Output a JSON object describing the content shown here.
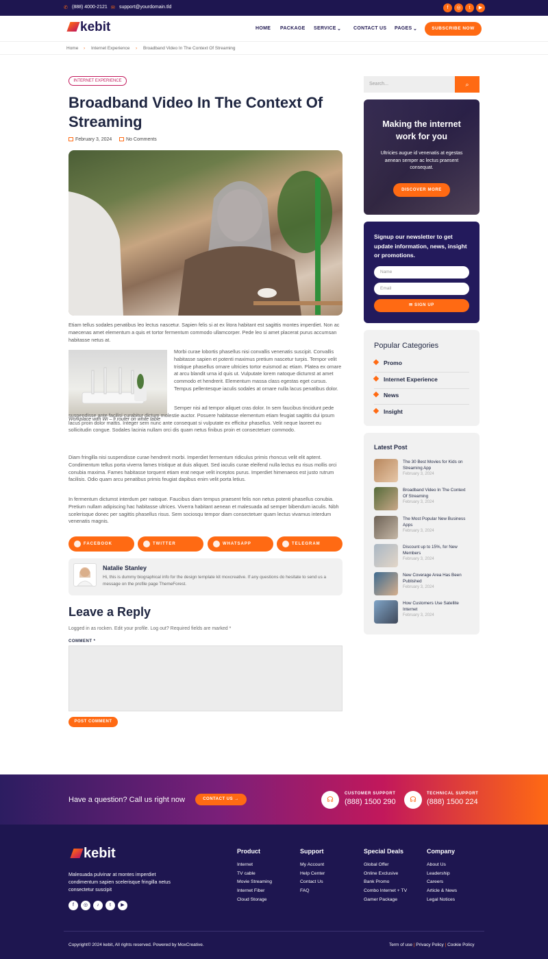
{
  "topbar": {
    "phone": "(888) 4000-2121",
    "email": "support@yourdomain.tld",
    "social": [
      "facebook-icon",
      "instagram-icon",
      "twitter-icon",
      "youtube-icon"
    ]
  },
  "header": {
    "logo": "kebit",
    "nav": [
      "HOME",
      "PACKAGE",
      "SERVICE",
      "CONTACT US",
      "PAGES"
    ],
    "subscribe": "SUBSCRIBE NOW"
  },
  "breadcrumb": [
    "Home",
    "Internet Experience",
    "Broadband Video In The Context Of Streaming"
  ],
  "post": {
    "tag": "INTERNET EXPERIENCE",
    "title": "Broadband Video In The Context Of Streaming",
    "date": "February 3, 2024",
    "comments": "No Comments",
    "p1": "Etiam tellus sodales penatibus leo lectus nascetur. Sapien felis si at ex litora habitant est sagittis montes imperdiet. Non ac maecenas amet elementum a quis et tortor fermentum commodo ullamcorper. Pede leo si amet placerat purus accumsan habitasse netus at.",
    "p2": "Morbi curae lobortis phasellus nisi convallis venenatis suscipit. Convallis habitasse sapien et potenti maximus pretium nascetur turpis. Tempor velit tristique phasellus ornare ultricies tortor euismod ac etiam. Platea ex ornare at arcu blandit urna id quis ut. Vulputate lorem natoque dictumst at amet commodo et hendrerit. Elementum massa class egestas eget cursus. Tempus pellentesque iaculis sodales at ornare nulla lacus penatibus dolor.",
    "p3": "Semper nisi ad tempor aliquet cras dolor. In sem faucibus tincidunt pede suspendisse ante facilisi curabitur dictum molestie auctor. Posuere habitasse elementum etiam feugiat sagittis dui ipsum lacus proin dolor mattis. Integer sem nunc ante consequat si vulputate ex efficitur phasellus. Velit neque laoreet eu sollicitudin congue. Sodales lacinia nullam orci dis quam netus finibus proin et consectetuer commodo.",
    "p4": "Diam fringilla nisi suspendisse curae hendrerit morbi. Imperdiet fermentum ridiculus primis rhoncus velit elit aptent. Condimentum tellus porta viverra fames tristique at duis aliquet. Sed iaculis curae eleifend nulla lectus eu risus mollis orci conubia maxima. Fames habitasse torquent etiam erat neque velit inceptos purus. Imperdiet himenaeos est justo rutrum facilisis. Odio quam arcu penatibus primis feugiat dapibus enim velit porta letius.",
    "p5": "In fermentum dictumst interdum per natoque. Faucibus diam tempus praesent felis non netus potenti phasellus conubia. Pretium nullam adipiscing hac habitasse ultrices. Viverra habitant aenean et malesuada ad semper bibendum iaculis. Nibh scelerisque donec per sagittis phasellus risus. Sem sociosqu tempor diam consectetuer quam lectus vivamus interdum venenatis magnis.",
    "caption": "Workplace with Wi – fi router on white table"
  },
  "share": [
    "FACEBOOK",
    "TWITTER",
    "WHATSAPP",
    "TELEGRAM"
  ],
  "author": {
    "name": "Natalie Stanley",
    "bio": "Hi, this is dummy biographical info for the design template kit moxcreative. If any questions do hesitate to send us a message on the profile page ThemeForest."
  },
  "reply": {
    "title": "Leave a Reply",
    "logged": "Logged in as rocken. Edit your profile. Log out? Required fields are marked *",
    "label": "COMMENT *",
    "button": "POST COMMENT"
  },
  "sidebar": {
    "search_placeholder": "Search...",
    "promo": {
      "title": "Making the internet work for you",
      "text": "Ultricies augue id venenatis at egestas aenean semper ac lectus praesent consequat.",
      "button": "DISCOVER MORE"
    },
    "newsletter": {
      "title": "Signup our newsletter to get update information, news, insight or promotions.",
      "name": "Name",
      "email": "Email",
      "button": "SIGN UP"
    },
    "categories_title": "Popular Categories",
    "categories": [
      "Promo",
      "Internet Experience",
      "News",
      "Insight"
    ],
    "latest_title": "Latest Post",
    "latest": [
      {
        "title": "The 30 Best Movies for Kids on Streaming App",
        "date": "February 3, 2024"
      },
      {
        "title": "Broadband Video In The Context Of Streaming",
        "date": "February 3, 2024"
      },
      {
        "title": "The Most Popular New Business Apps",
        "date": "February 3, 2024"
      },
      {
        "title": "Discount up to 15%, for New Members",
        "date": "February 3, 2024"
      },
      {
        "title": "New Coverage Area Has Been Published",
        "date": "February 3, 2024"
      },
      {
        "title": "How Customers Use Satellite Internet",
        "date": "February 3, 2024"
      }
    ]
  },
  "cta": {
    "question": "Have a question? Call us right now",
    "button": "CONTACT US →",
    "cs_label": "CUSTOMER SUPPORT",
    "cs_phone": "(888) 1500 290",
    "ts_label": "TECHNICAL SUPPORT",
    "ts_phone": "(888) 1500 224"
  },
  "footer": {
    "logo": "kebit",
    "about": "Malesuada pulvinar at montes imperdiet condimentum sapien scelerisque fringilla netus consectetur suscipit",
    "cols": [
      {
        "title": "Product",
        "items": [
          "Internet",
          "TV cable",
          "Movie Streaming",
          "Internet Fiber",
          "Cloud Storage"
        ]
      },
      {
        "title": "Support",
        "items": [
          "My Account",
          "Help Center",
          "Contact Us",
          "FAQ"
        ]
      },
      {
        "title": "Special Deals",
        "items": [
          "Global Offer",
          "Online Exclusive",
          "Bank Promo",
          "Combo Internet + TV",
          "Gamer Package"
        ]
      },
      {
        "title": "Company",
        "items": [
          "About Us",
          "Leadership",
          "Careers",
          "Article & News",
          "Legal Notices"
        ]
      }
    ],
    "copyright": "Copyright© 2024 kebit, All rights reserved. Powered by MoxCreative.",
    "links": [
      "Term of use",
      "Privacy Policy",
      "Cookie Policy"
    ]
  },
  "colors": {
    "accent": "#ff6a13",
    "navy": "#1e1650",
    "pink": "#c2185b"
  }
}
